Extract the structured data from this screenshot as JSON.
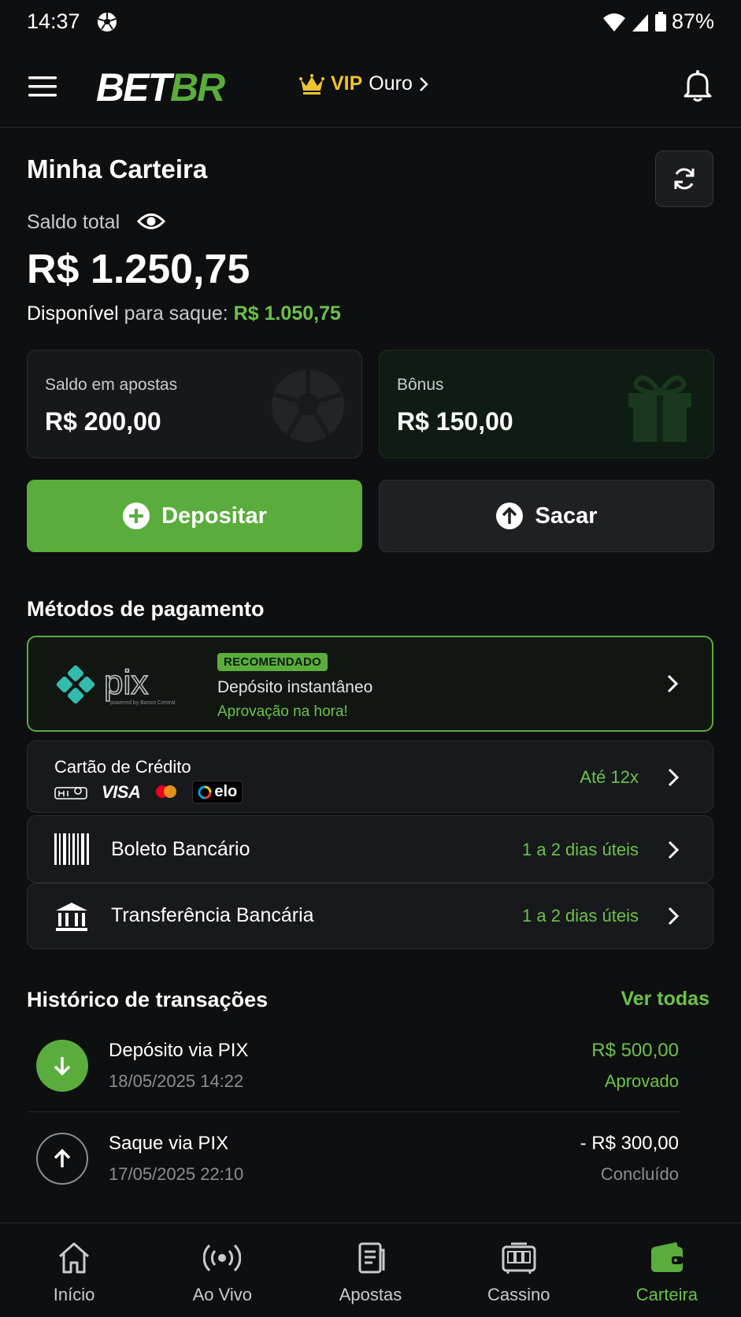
{
  "status_bar": {
    "time": "14:37",
    "battery": "87%"
  },
  "header": {
    "logo_bet": "BET",
    "logo_br": "BR",
    "vip_word": "VIP",
    "vip_level": "Ouro"
  },
  "wallet": {
    "title": "Minha Carteira",
    "saldo_label": "Saldo total",
    "saldo_value": "R$ 1.250,75",
    "disponivel_1": "Disponível",
    "disponivel_2": " para saque: ",
    "disponivel_value": "R$ 1.050,75"
  },
  "cards": {
    "apostas_label": "Saldo em apostas",
    "apostas_value": "R$ 200,00",
    "bonus_label": "Bônus",
    "bonus_value": "R$ 150,00"
  },
  "actions": {
    "deposit": "Depositar",
    "withdraw": "Sacar"
  },
  "payment": {
    "title": "Métodos de pagamento",
    "pix": {
      "logo_text": "pix",
      "logo_sub": "powered by Banco Central",
      "badge": "RECOMENDADO",
      "desc": "Depósito instantâneo",
      "sub": "Aprovação na hora!"
    },
    "card": {
      "label": "Cartão de Crédito",
      "meta": "Até 12x",
      "brand_visa": "VISA",
      "brand_elo": "elo"
    },
    "boleto": {
      "label": "Boleto Bancário",
      "meta": "1 a 2 dias úteis"
    },
    "transfer": {
      "label": "Transferência Bancária",
      "meta": "1 a 2 dias úteis"
    }
  },
  "history": {
    "title": "Histórico de transações",
    "see_all": "Ver todas",
    "items": [
      {
        "name": "Depósito via PIX",
        "date": "18/05/2025 14:22",
        "amount": "R$ 500,00",
        "status": "Aprovado",
        "color": "#6cc24a"
      },
      {
        "name": "Saque via PIX",
        "date": "17/05/2025 22:10",
        "amount": "- R$ 300,00",
        "status": "Concluído",
        "color": "#ffffff"
      }
    ]
  },
  "nav": {
    "items": [
      {
        "label": "Início",
        "icon": "home-icon"
      },
      {
        "label": "Ao Vivo",
        "icon": "live-icon"
      },
      {
        "label": "Apostas",
        "icon": "bets-icon"
      },
      {
        "label": "Cassino",
        "icon": "casino-icon"
      },
      {
        "label": "Carteira",
        "icon": "wallet-icon"
      }
    ],
    "active": "Carteira"
  },
  "colors": {
    "accent": "#5aad3c",
    "accent_text": "#6cc24a",
    "vip_gold": "#f0c232",
    "background": "#0e0f11"
  }
}
